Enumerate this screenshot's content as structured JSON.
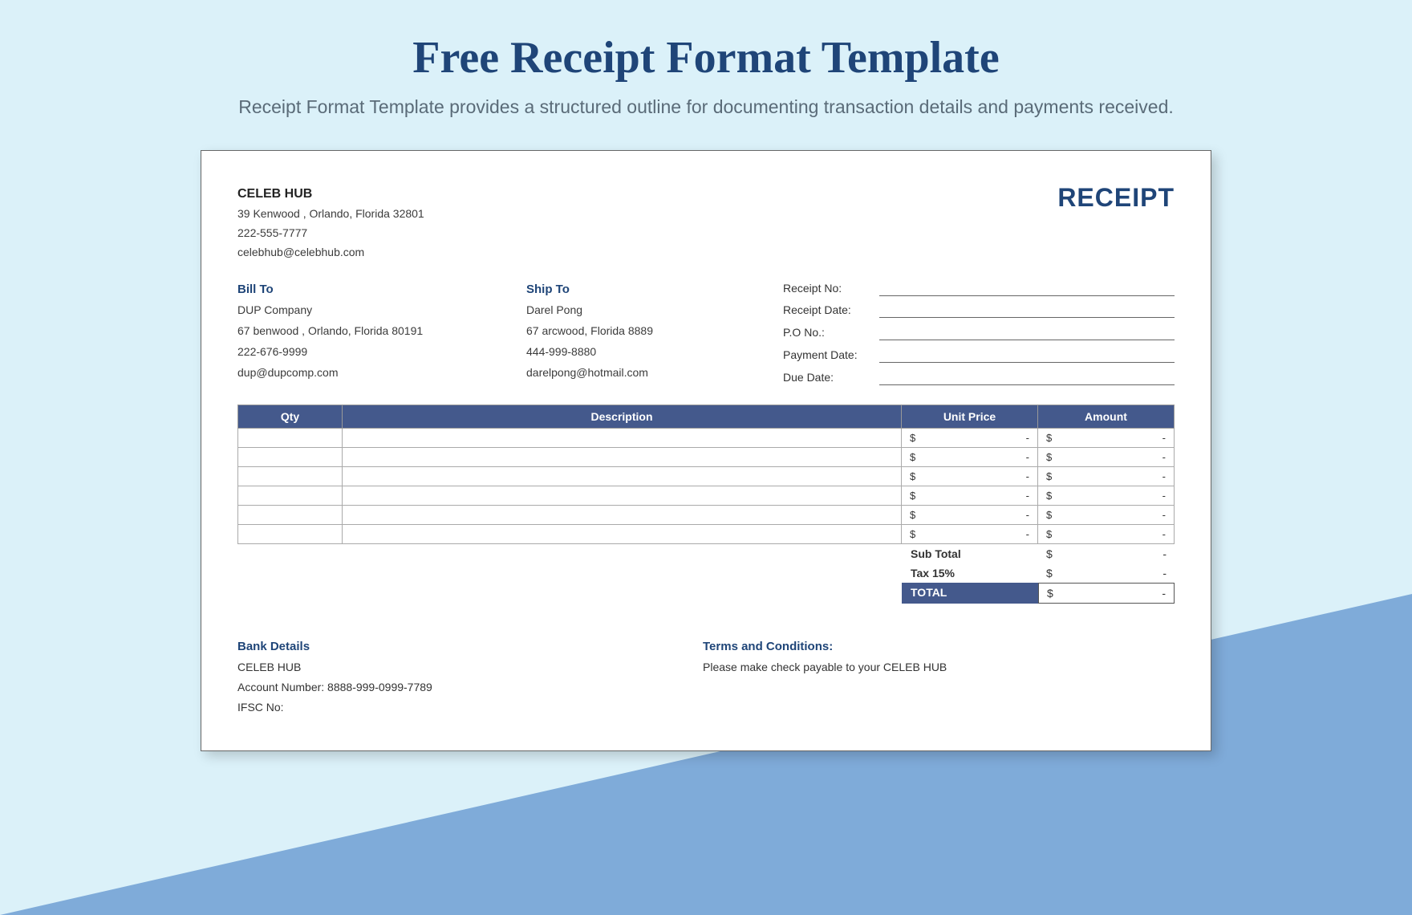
{
  "page": {
    "title": "Free Receipt Format Template",
    "subtitle": "Receipt Format Template provides a structured outline for documenting transaction details and payments received."
  },
  "receipt": {
    "label": "RECEIPT",
    "company": {
      "name": "CELEB HUB",
      "address": "39 Kenwood , Orlando, Florida 32801",
      "phone": "222-555-7777",
      "email": "celebhub@celebhub.com"
    },
    "billTo": {
      "label": "Bill To",
      "name": "DUP Company",
      "address": "67 benwood , Orlando, Florida 80191",
      "phone": "222-676-9999",
      "email": "dup@dupcomp.com"
    },
    "shipTo": {
      "label": "Ship To",
      "name": "Darel Pong",
      "address": "67 arcwood, Florida 8889",
      "phone": "444-999-8880",
      "email": "darelpong@hotmail.com"
    },
    "meta": {
      "receiptNo": "Receipt No:",
      "receiptDate": "Receipt Date:",
      "poNo": "P.O No.:",
      "paymentDate": "Payment Date:",
      "dueDate": "Due Date:"
    },
    "table": {
      "headers": {
        "qty": "Qty",
        "desc": "Description",
        "price": "Unit Price",
        "amount": "Amount"
      },
      "rows": [
        {
          "price_sym": "$",
          "price_val": "-",
          "amt_sym": "$",
          "amt_val": "-"
        },
        {
          "price_sym": "$",
          "price_val": "-",
          "amt_sym": "$",
          "amt_val": "-"
        },
        {
          "price_sym": "$",
          "price_val": "-",
          "amt_sym": "$",
          "amt_val": "-"
        },
        {
          "price_sym": "$",
          "price_val": "-",
          "amt_sym": "$",
          "amt_val": "-"
        },
        {
          "price_sym": "$",
          "price_val": "-",
          "amt_sym": "$",
          "amt_val": "-"
        },
        {
          "price_sym": "$",
          "price_val": "-",
          "amt_sym": "$",
          "amt_val": "-"
        }
      ]
    },
    "totals": {
      "subtotal": {
        "label": "Sub Total",
        "sym": "$",
        "val": "-"
      },
      "tax": {
        "label": "Tax 15%",
        "sym": "$",
        "val": "-"
      },
      "total": {
        "label": "TOTAL",
        "sym": "$",
        "val": "-"
      }
    },
    "bank": {
      "label": "Bank Details",
      "name": "CELEB HUB",
      "account": "Account Number: 8888-999-0999-7789",
      "ifsc": "IFSC No:"
    },
    "terms": {
      "label": "Terms and Conditions:",
      "text": "Please make check payable to your CELEB HUB"
    }
  }
}
